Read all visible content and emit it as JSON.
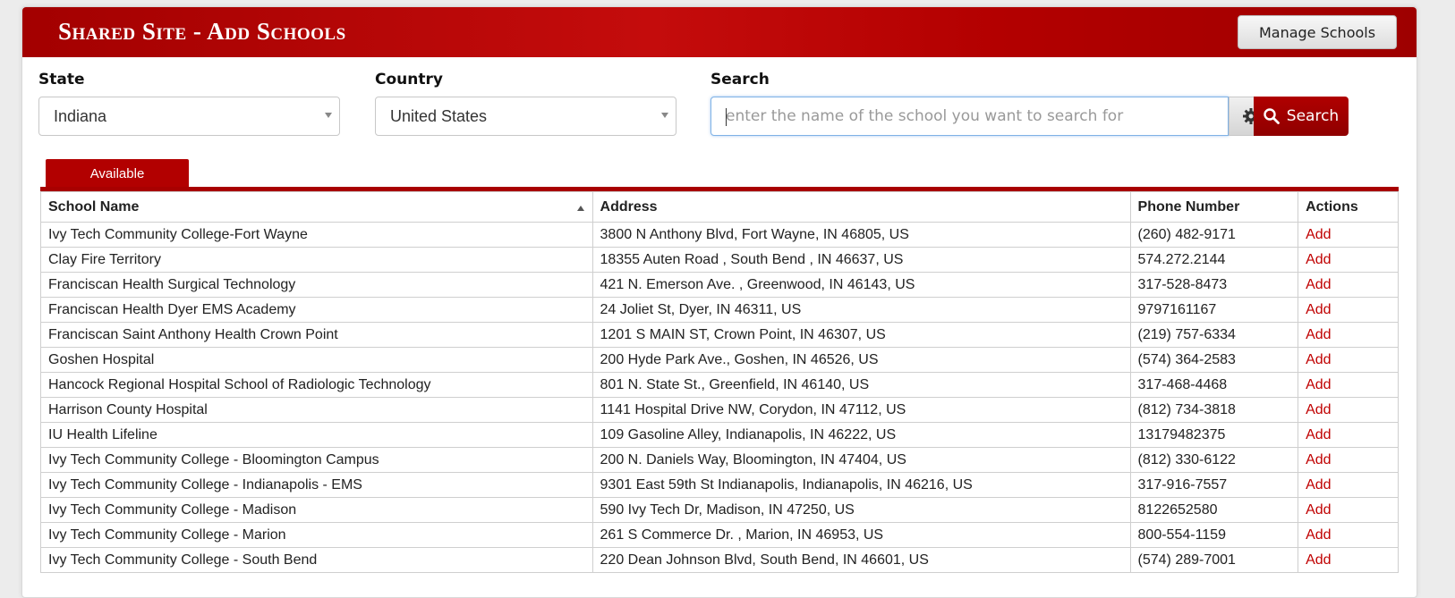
{
  "header": {
    "title": "Shared Site - Add Schools",
    "manage_button": "Manage Schools"
  },
  "filters": {
    "state_label": "State",
    "state_value": "Indiana",
    "country_label": "Country",
    "country_value": "United States",
    "search_label": "Search",
    "search_placeholder": "enter the name of the school you want to search for",
    "search_button": "Search"
  },
  "tabs": {
    "available": "Available"
  },
  "table": {
    "headers": [
      "School Name",
      "Address",
      "Phone Number",
      "Actions"
    ],
    "rows": [
      {
        "name": "Ivy Tech Community College-Fort Wayne",
        "address": "3800 N Anthony Blvd, Fort Wayne, IN 46805, US",
        "phone": "(260) 482-9171",
        "action": "Add"
      },
      {
        "name": "Clay Fire Territory",
        "address": "18355 Auten Road , South Bend , IN 46637, US",
        "phone": "574.272.2144",
        "action": "Add"
      },
      {
        "name": "Franciscan Health Surgical Technology",
        "address": "421 N. Emerson Ave. , Greenwood, IN 46143, US",
        "phone": "317-528-8473",
        "action": "Add"
      },
      {
        "name": "Franciscan Health Dyer EMS Academy",
        "address": "24 Joliet St, Dyer, IN 46311, US",
        "phone": "9797161167",
        "action": "Add"
      },
      {
        "name": "Franciscan Saint Anthony Health Crown Point",
        "address": "1201 S MAIN ST, Crown Point, IN 46307, US",
        "phone": "(219) 757-6334",
        "action": "Add"
      },
      {
        "name": "Goshen Hospital",
        "address": "200 Hyde Park Ave., Goshen, IN 46526, US",
        "phone": "(574) 364-2583",
        "action": "Add"
      },
      {
        "name": "Hancock Regional Hospital School of Radiologic Technology",
        "address": "801 N. State St., Greenfield, IN 46140, US",
        "phone": "317-468-4468",
        "action": "Add"
      },
      {
        "name": "Harrison County Hospital",
        "address": "1141 Hospital Drive NW, Corydon, IN 47112, US",
        "phone": "(812) 734-3818",
        "action": "Add"
      },
      {
        "name": "IU Health Lifeline",
        "address": "109 Gasoline Alley, Indianapolis, IN 46222, US",
        "phone": "13179482375",
        "action": "Add"
      },
      {
        "name": "Ivy Tech Community College - Bloomington Campus",
        "address": "200 N. Daniels Way, Bloomington, IN 47404, US",
        "phone": "(812) 330-6122",
        "action": "Add"
      },
      {
        "name": "Ivy Tech Community College - Indianapolis - EMS",
        "address": "9301 East 59th St Indianapolis, Indianapolis, IN 46216, US",
        "phone": "317-916-7557",
        "action": "Add"
      },
      {
        "name": "Ivy Tech Community College - Madison",
        "address": "590 Ivy Tech Dr, Madison, IN 47250, US",
        "phone": "8122652580",
        "action": "Add"
      },
      {
        "name": "Ivy Tech Community College - Marion",
        "address": "261 S Commerce Dr. , Marion, IN 46953, US",
        "phone": "800-554-1159",
        "action": "Add"
      },
      {
        "name": "Ivy Tech Community College - South Bend",
        "address": "220 Dean Johnson Blvd, South Bend, IN 46601, US",
        "phone": "(574) 289-7001",
        "action": "Add"
      }
    ]
  },
  "icons": {
    "gear": "gear-icon",
    "search": "search-icon",
    "sort": "sort-ascending-icon",
    "dropdown": "chevron-down-icon"
  },
  "colors": {
    "brand": "#b20000",
    "link": "#c00000"
  }
}
